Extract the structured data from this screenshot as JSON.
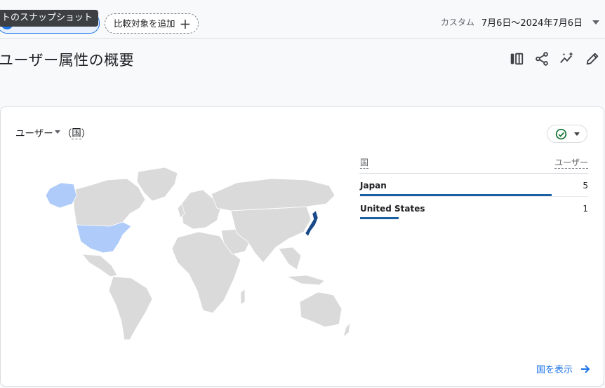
{
  "header": {
    "tooltip": "トのスナップショット",
    "compare_label": "比較対象を追加",
    "date_preset": "カスタム",
    "date_range": "7月6日～2024年7月6日"
  },
  "page": {
    "title": "ユーザー属性の概要"
  },
  "card": {
    "metric_label": "ユーザー",
    "dimension_open": "（",
    "dimension_label": "国",
    "dimension_close": "）",
    "table": {
      "col_dimension": "国",
      "col_metric": "ユーザー",
      "rows": [
        {
          "country": "Japan",
          "users": "5",
          "share": 1.0
        },
        {
          "country": "United States",
          "users": "1",
          "share": 0.2
        }
      ]
    },
    "view_link": "国を表示"
  },
  "map_colors": {
    "base": "#dadada",
    "japan": "#1a4a8a",
    "united_states": "#aecbfa"
  }
}
